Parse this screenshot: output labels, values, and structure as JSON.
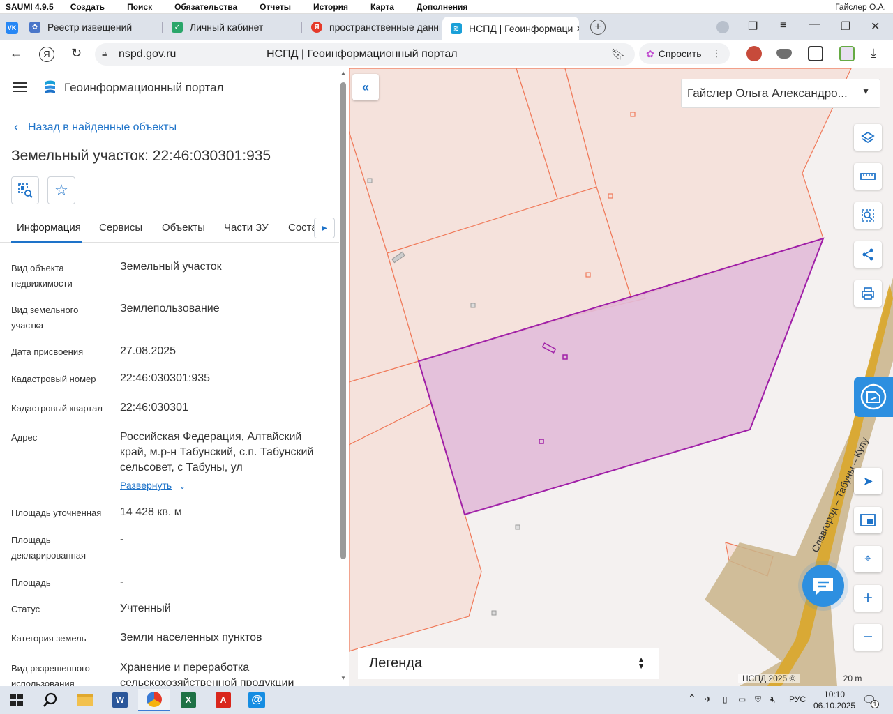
{
  "app_menu": {
    "items": [
      "SAUMI 4.9.5",
      "Создать",
      "Поиск",
      "Обязательства",
      "Отчеты",
      "История",
      "Карта",
      "Дополнения"
    ],
    "user": "Гайслер О.А."
  },
  "browser": {
    "tabs": [
      {
        "label": "Реестр извещений",
        "icon": "vk-icon"
      },
      {
        "label": "Личный кабинет",
        "icon": "gosuslugi-icon"
      },
      {
        "label": "пространственные данны",
        "icon": "yandex-icon"
      },
      {
        "label": "НСПД | Геоинформаци",
        "icon": "nspd-icon",
        "active": true
      }
    ],
    "url": "nspd.gov.ru",
    "page_title": "НСПД | Геоинформационный портал",
    "ask_label": "Спросить"
  },
  "panel": {
    "portal_title": "Геоинформационный портал",
    "back_label": "Назад в найденные объекты",
    "object_title": "Земельный участок: 22:46:030301:935",
    "tabs": [
      "Информация",
      "Сервисы",
      "Объекты",
      "Части ЗУ",
      "Соста"
    ],
    "fields": [
      {
        "label": "Вид объекта недвижимости",
        "value": "Земельный участок"
      },
      {
        "label": "Вид земельного участка",
        "value": "Землепользование"
      },
      {
        "label": "Дата присвоения",
        "value": "27.08.2025"
      },
      {
        "label": "Кадастровый номер",
        "value": "22:46:030301:935"
      },
      {
        "label": "Кадастровый квартал",
        "value": "22:46:030301"
      },
      {
        "label": "Адрес",
        "value": "Российская Федерация, Алтайский край, м.р-н Табунский, с.п. Табунский сельсовет, с Табуны, ул"
      },
      {
        "label": "Площадь уточненная",
        "value": "14 428 кв. м"
      },
      {
        "label": "Площадь декларированная",
        "value": "-"
      },
      {
        "label": "Площадь",
        "value": "-"
      },
      {
        "label": "Статус",
        "value": "Учтенный"
      },
      {
        "label": "Категория земель",
        "value": "Земли населенных пунктов"
      },
      {
        "label": "Вид разрешенного использования",
        "value": "Хранение и переработка сельскохозяйственной продукции"
      }
    ],
    "expand_label": "Развернуть"
  },
  "map": {
    "user_name": "Гайслер Ольга Александро...",
    "legend_label": "Легенда",
    "copyright": "НСПД 2025 ©",
    "scale_label": "20 m",
    "road_label": "Славгород – Табуны – Кулу",
    "colors": {
      "parcel_fill": "#f5e2dc",
      "parcel_stroke": "#f07a5a",
      "selected_fill": "#e2bbd8",
      "selected_stroke": "#a020a8",
      "road": "#c9b48a",
      "accent": "#1e73c9"
    }
  },
  "taskbar": {
    "lang": "РУС",
    "time": "10:10",
    "date": "06.10.2025",
    "notifications": "1"
  }
}
